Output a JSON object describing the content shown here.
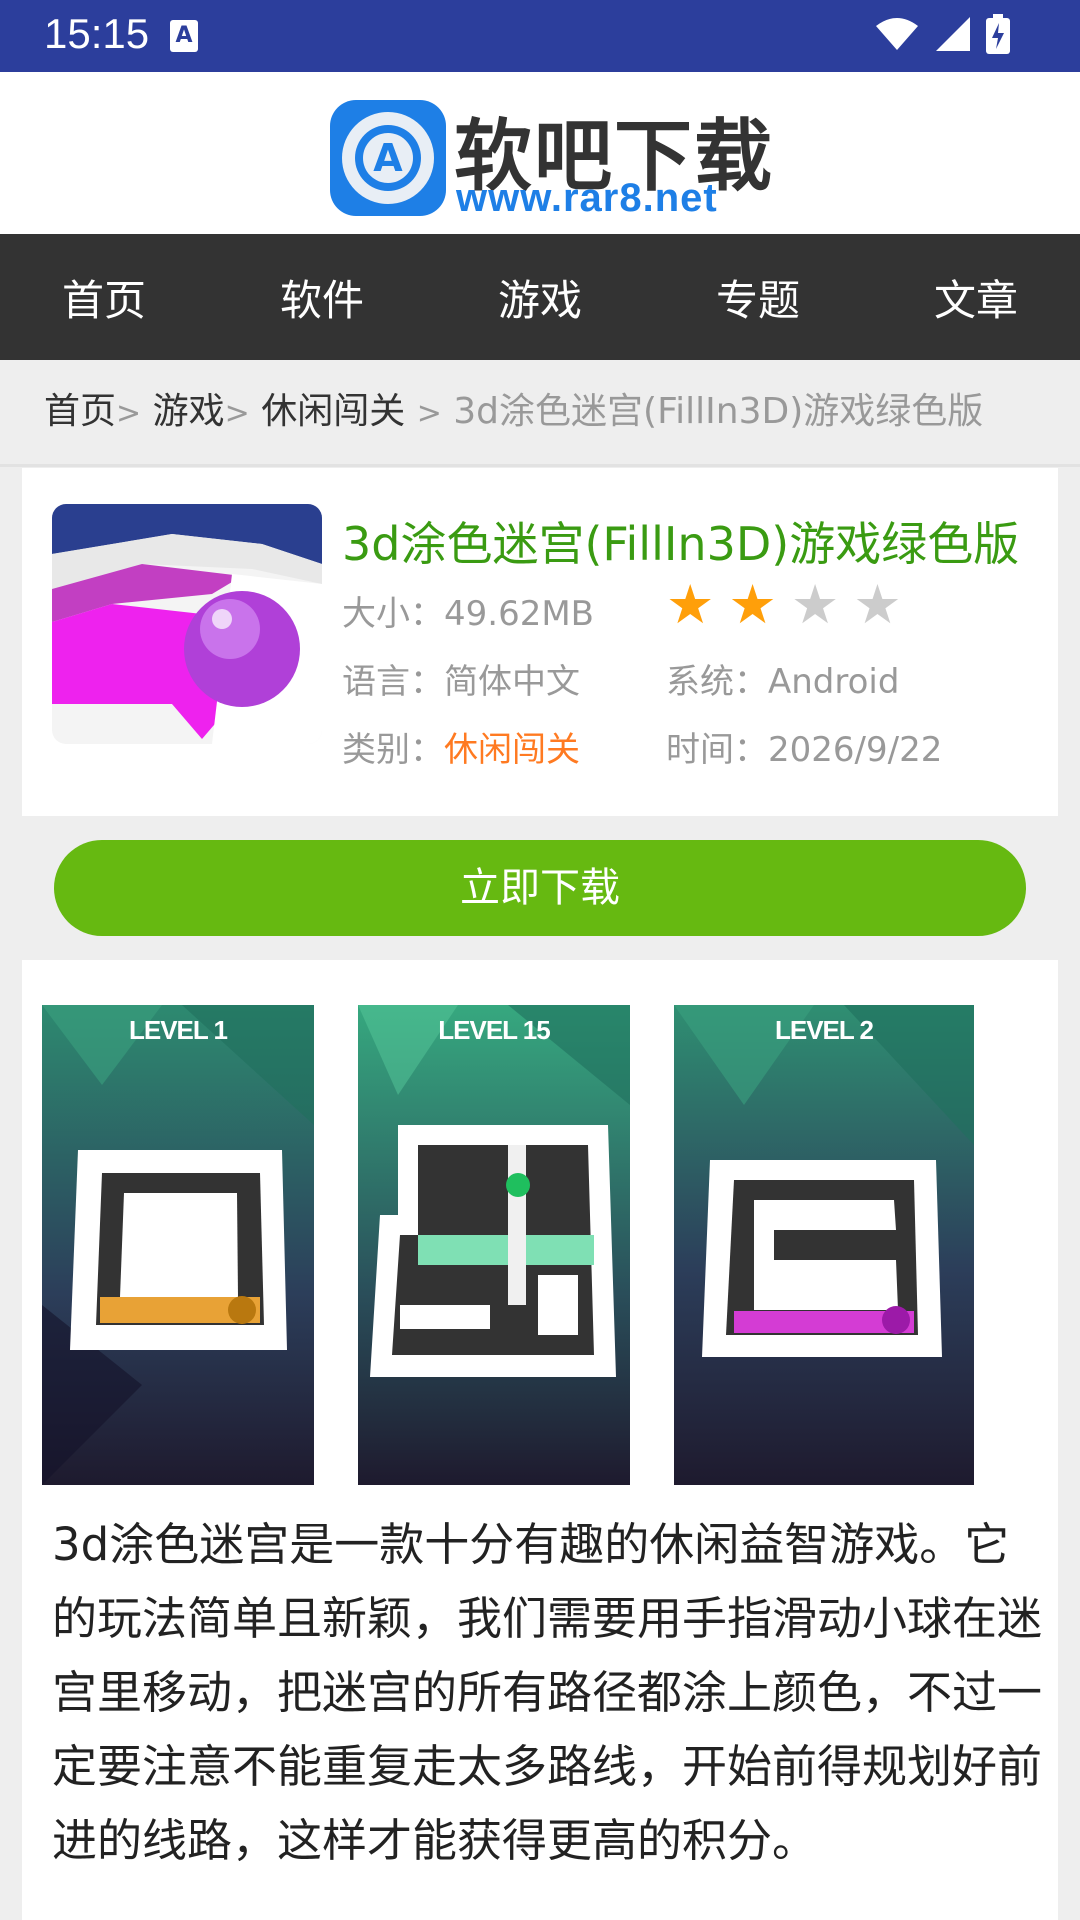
{
  "status_bar": {
    "time": "15:15",
    "notif_icon_letter": "A"
  },
  "header": {
    "logo_name": "软吧下载",
    "logo_url": "www.rar8.net",
    "logo_icon_letter": "A"
  },
  "nav": {
    "items": [
      "首页",
      "软件",
      "游戏",
      "专题",
      "文章"
    ]
  },
  "breadcrumb": {
    "items": [
      "首页",
      "游戏",
      "休闲闯关"
    ],
    "current": "3d涂色迷宫(FillIn3D)游戏绿色版",
    "separator": ">"
  },
  "app": {
    "title": "3d涂色迷宫(FillIn3D)游戏绿色版",
    "size_label": "大小：",
    "size": "49.62MB",
    "rating": 2,
    "rating_max": 5,
    "language_label": "语言：",
    "language": "简体中文",
    "system_label": "系统：",
    "system": "Android",
    "category_label": "类别：",
    "category": "休闲闯关",
    "time_label": "时间：",
    "time": "2026/9/22"
  },
  "download_button": "立即下载",
  "screenshots": [
    {
      "level": "LEVEL 1",
      "accent": "#e8a236"
    },
    {
      "level": "LEVEL 15",
      "accent": "#7fe0b4"
    },
    {
      "level": "LEVEL 2",
      "accent": "#d43cd4"
    }
  ],
  "description": "3d涂色迷宫是一款十分有趣的休闲益智游戏。它的玩法简单且新颖，我们需要用手指滑动小球在迷宫里移动，把迷宫的所有路径都涂上颜色，不过一定要注意不能重复走太多路线，开始前得规划好前进的线路，这样才能获得更高的积分。",
  "colors": {
    "status_bar": "#2c3e9c",
    "nav_bg": "#333333",
    "title_green": "#3a9b12",
    "button_green": "#66b911",
    "star_active": "#ff9f0a",
    "star_inactive": "#cccccc",
    "category_orange": "#ff7a21"
  }
}
